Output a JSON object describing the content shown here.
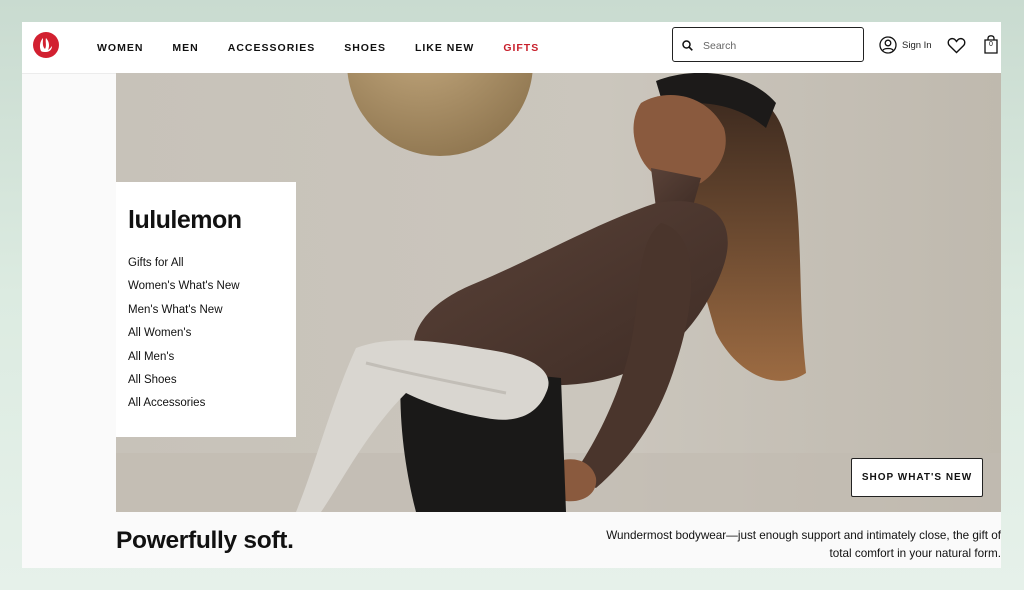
{
  "header": {
    "nav": [
      "WOMEN",
      "MEN",
      "ACCESSORIES",
      "SHOES",
      "LIKE NEW",
      "GIFTS"
    ],
    "search": {
      "placeholder": "Search"
    },
    "sign_in_label": "Sign In",
    "bag_count": "0",
    "icons": {
      "logo": "lululemon-logo",
      "search": "search-icon",
      "account": "user-icon",
      "wishlist": "heart-icon",
      "bag": "shopping-bag-icon"
    },
    "gifts_color": "#c8202c"
  },
  "sidebar": {
    "brand": "lululemon",
    "links": [
      "Gifts for All",
      "Women's What's New",
      "Men's What's New",
      "All Women's",
      "All Men's",
      "All Shoes",
      "All Accessories"
    ]
  },
  "hero": {
    "cta_label": "SHOP WHAT'S NEW",
    "tagline": "Powerfully soft.",
    "description_line1": "Wundermost bodywear—just enough support and intimately close, the gift of",
    "description_line2": "total comfort in your natural form."
  },
  "colors": {
    "brand_red": "#d22030",
    "hero_bg": "#c6c0b7",
    "top_brown": "#4a352c"
  }
}
